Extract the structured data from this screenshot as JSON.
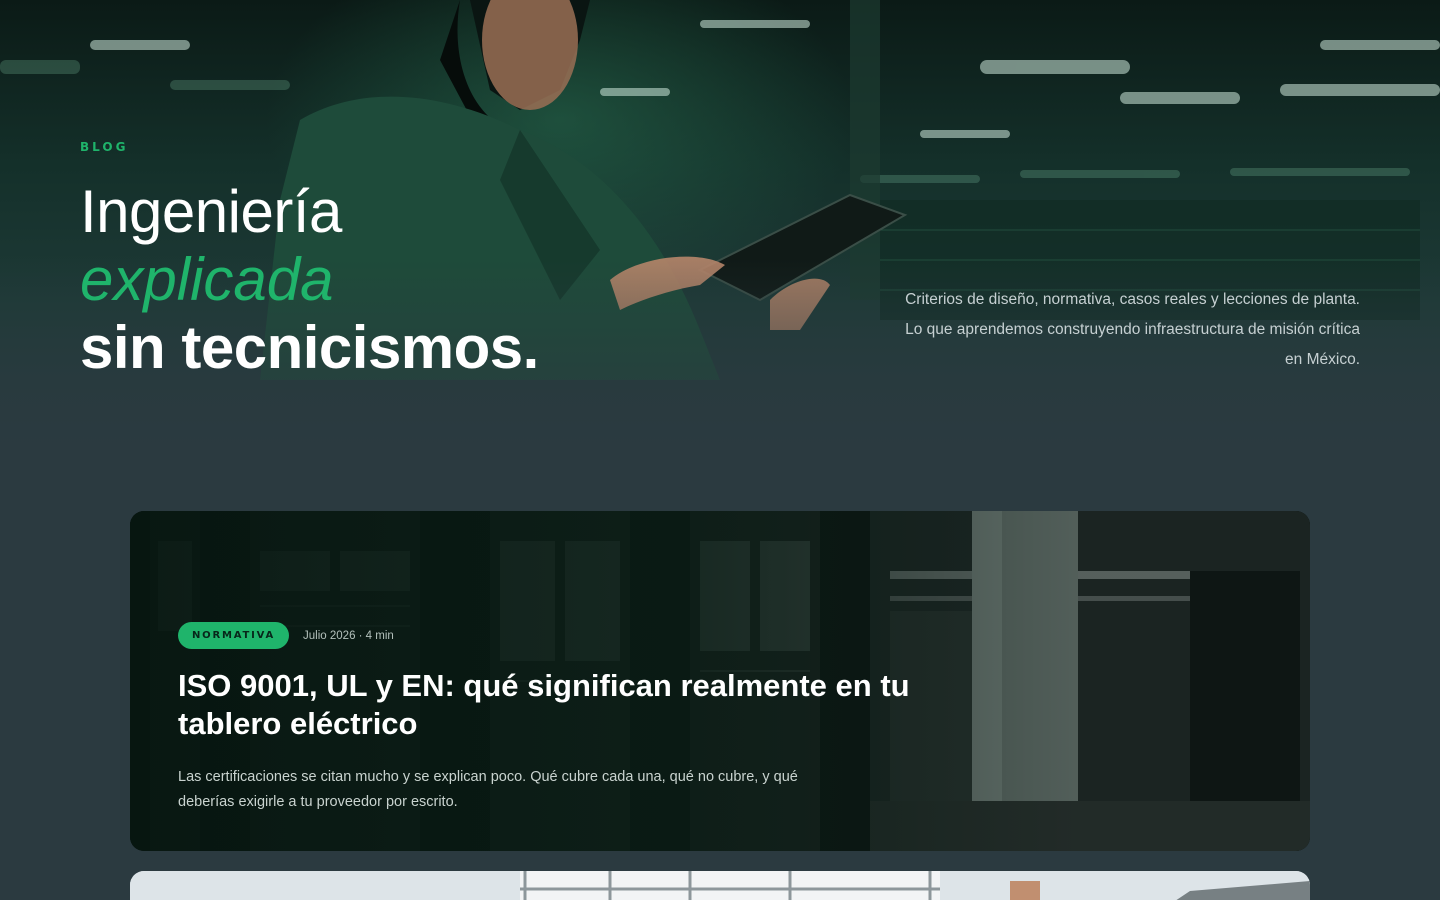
{
  "hero": {
    "eyebrow": "BLOG",
    "title_line1": "Ingeniería",
    "title_line2": "explicada",
    "title_line3": "sin tecnicismos.",
    "description": "Criterios de diseño, normativa, casos reales y lecciones de planta. Lo que aprendemos construyendo infraestructura de misión crítica en México."
  },
  "featured": {
    "tag": "NORMATIVA",
    "meta": "Julio 2026 · 4 min",
    "title": "ISO 9001, UL y EN: qué significan realmente en tu tablero eléctrico",
    "excerpt": "Las certificaciones se citan mucho y se explican poco. Qué cubre cada una, qué no cubre, y qué deberías exigirle a tu proveedor por escrito."
  },
  "colors": {
    "accent": "#1fb46b",
    "background": "#2b3a40",
    "text": "#ffffff"
  }
}
